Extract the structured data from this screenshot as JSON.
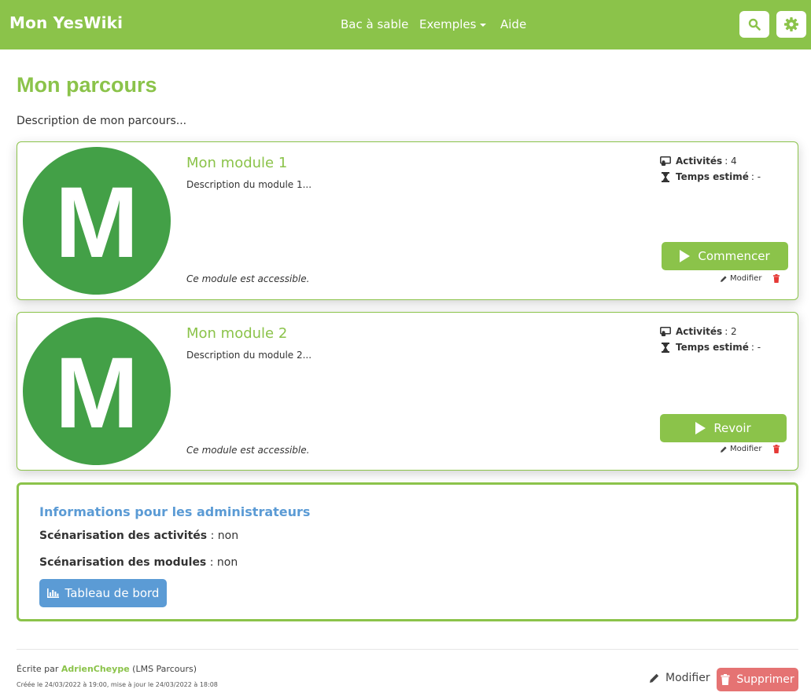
{
  "colors": {
    "brand_green": "#8bc34a",
    "avatar_green": "#43a047",
    "info_blue": "#5b9bd5",
    "danger_red": "#e57373"
  },
  "header": {
    "brand": "Mon YesWiki",
    "nav": [
      {
        "label": "Bac à sable"
      },
      {
        "label": "Exemples",
        "has_dropdown": true
      },
      {
        "label": "Aide"
      }
    ],
    "icons": [
      "search-icon",
      "gear-icon"
    ]
  },
  "page": {
    "title": "Mon parcours",
    "description": "Description de mon parcours..."
  },
  "modules": [
    {
      "avatar_letter": "M",
      "title": "Mon module 1",
      "description": "Description du module 1...",
      "access": "Ce module est accessible.",
      "activities_label": "Activités",
      "activities_value": ": 4",
      "time_label": "Temps estimé",
      "time_value": ": -",
      "action_label": "Commencer",
      "edit_label": "Modifier"
    },
    {
      "avatar_letter": "M",
      "title": "Mon module 2",
      "description": "Description du module 2...",
      "access": "Ce module est accessible.",
      "activities_label": "Activités",
      "activities_value": ": 2",
      "time_label": "Temps estimé",
      "time_value": ": -",
      "action_label": "Revoir",
      "edit_label": "Modifier"
    }
  ],
  "admin": {
    "title": "Informations pour les administrateurs",
    "activities_label": "Scénarisation des activités",
    "activities_value": " : non",
    "modules_label": "Scénarisation des modules",
    "modules_value": " : non",
    "dashboard_label": "Tableau de bord"
  },
  "footer": {
    "written_prefix": "Écrite par ",
    "author": "AdrienCheype",
    "written_suffix": " (LMS Parcours)",
    "dates": "Créée le 24/03/2022 à 19:00, mise à jour le 24/03/2022 à 18:08",
    "edit_label": "Modifier",
    "delete_label": "Supprimer"
  }
}
